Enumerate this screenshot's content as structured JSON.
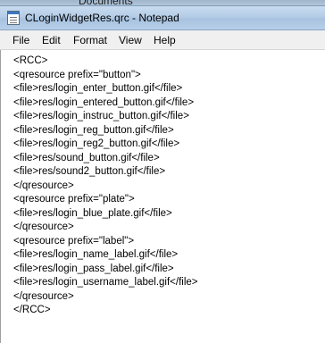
{
  "background_window": {
    "title": "Documents"
  },
  "window": {
    "title": "CLoginWidgetRes.qrc - Notepad",
    "icon": "notepad-icon"
  },
  "menu": {
    "file": "File",
    "edit": "Edit",
    "format": "Format",
    "view": "View",
    "help": "Help"
  },
  "editor": {
    "lines": [
      "<RCC>",
      "<qresource prefix=\"button\">",
      "<file>res/login_enter_button.gif</file>",
      "<file>res/login_entered_button.gif</file>",
      "<file>res/login_instruc_button.gif</file>",
      "<file>res/login_reg_button.gif</file>",
      "<file>res/login_reg2_button.gif</file>",
      "<file>res/sound_button.gif</file>",
      "<file>res/sound2_button.gif</file>",
      "</qresource>",
      "<qresource prefix=\"plate\">",
      "<file>res/login_blue_plate.gif</file>",
      "</qresource>",
      "<qresource prefix=\"label\">",
      "<file>res/login_name_label.gif</file>",
      "<file>res/login_pass_label.gif</file>",
      "<file>res/login_username_label.gif</file>",
      "</qresource>",
      "</RCC>"
    ]
  },
  "colors": {
    "titlebar": "#b4cce6",
    "menubar": "#f0f0f0",
    "editor_background": "#ffffff",
    "text": "#000000"
  }
}
